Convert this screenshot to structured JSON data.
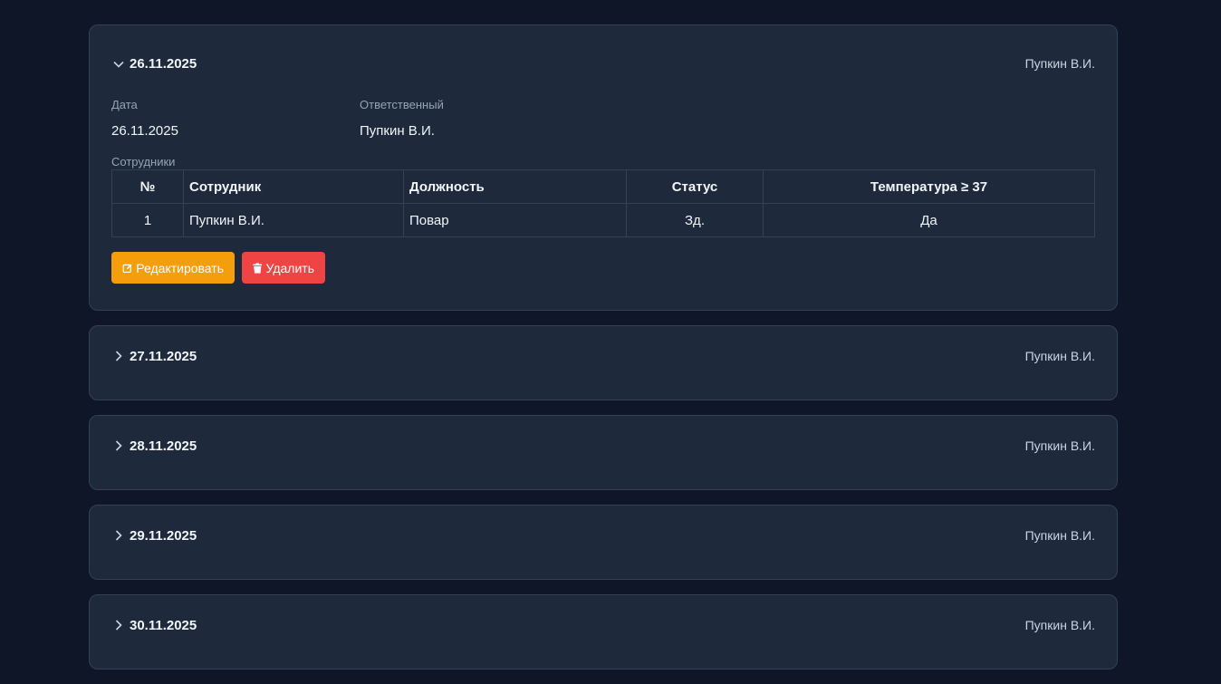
{
  "entries": [
    {
      "date": "26.11.2025",
      "responsible": "Пупкин В.И.",
      "expanded": true,
      "fields": {
        "date_label": "Дата",
        "date_value": "26.11.2025",
        "resp_label": "Ответственный",
        "resp_value": "Пупкин В.И."
      },
      "employees_label": "Сотрудники",
      "table": {
        "headers": [
          "№",
          "Сотрудник",
          "Должность",
          "Статус",
          "Температура ≥ 37"
        ],
        "rows": [
          [
            "1",
            "Пупкин В.И.",
            "Повар",
            "Зд.",
            "Да"
          ]
        ]
      },
      "actions": {
        "edit_label": "Редактировать",
        "delete_label": "Удалить"
      }
    },
    {
      "date": "27.11.2025",
      "responsible": "Пупкин В.И.",
      "expanded": false
    },
    {
      "date": "28.11.2025",
      "responsible": "Пупкин В.И.",
      "expanded": false
    },
    {
      "date": "29.11.2025",
      "responsible": "Пупкин В.И.",
      "expanded": false
    },
    {
      "date": "30.11.2025",
      "responsible": "Пупкин В.И.",
      "expanded": false
    }
  ],
  "colors": {
    "background": "#0e1628",
    "card": "#1e293b",
    "border": "#334155",
    "edit": "#f59e0b",
    "delete": "#ef4444"
  },
  "icons": {
    "expanded": "chevron-down-icon",
    "collapsed": "chevron-right-icon",
    "edit": "edit-icon",
    "delete": "trash-icon"
  }
}
